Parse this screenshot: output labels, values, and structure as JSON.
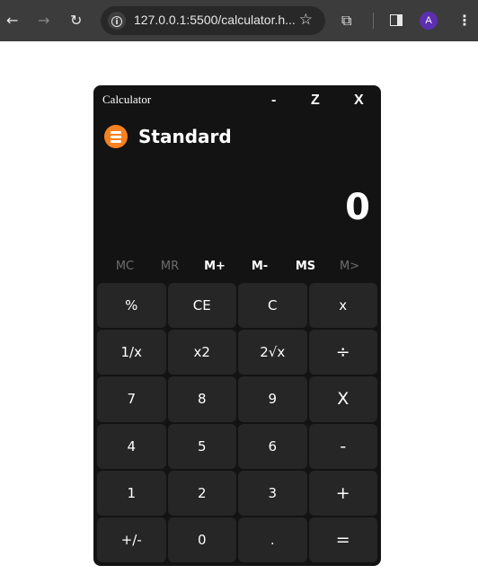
{
  "browser": {
    "url": "127.0.0.1:5500/calculator.h...",
    "avatar_initial": "A",
    "icons": {
      "back": "←",
      "forward": "→",
      "reload": "↻",
      "info": "i",
      "star": "☆",
      "extensions": "⧉",
      "menu": "⋮"
    },
    "colors": {
      "toolbar": "#3c3c3c",
      "omnibox": "#282828",
      "avatar": "#5b2fb0"
    }
  },
  "calculator": {
    "title": "Calculator",
    "window_controls": {
      "minimize": "-",
      "maximize": "Z",
      "close": "X"
    },
    "mode": "Standard",
    "display": "0",
    "memory": [
      {
        "label": "MC",
        "enabled": false
      },
      {
        "label": "MR",
        "enabled": false
      },
      {
        "label": "M+",
        "enabled": true
      },
      {
        "label": "M-",
        "enabled": true
      },
      {
        "label": "MS",
        "enabled": true
      },
      {
        "label": "M>",
        "enabled": false
      }
    ],
    "keys": [
      [
        "%",
        "CE",
        "C",
        "x"
      ],
      [
        "1/x",
        "x2",
        "2√x",
        "÷"
      ],
      [
        "7",
        "8",
        "9",
        "X"
      ],
      [
        "4",
        "5",
        "6",
        "-"
      ],
      [
        "1",
        "2",
        "3",
        "+"
      ],
      [
        "+/-",
        "0",
        ".",
        "="
      ]
    ],
    "colors": {
      "background": "#131313",
      "key": "#262626",
      "accent": "#f58220",
      "text": "#ffffff",
      "disabled_text": "#6d6d6d"
    }
  }
}
